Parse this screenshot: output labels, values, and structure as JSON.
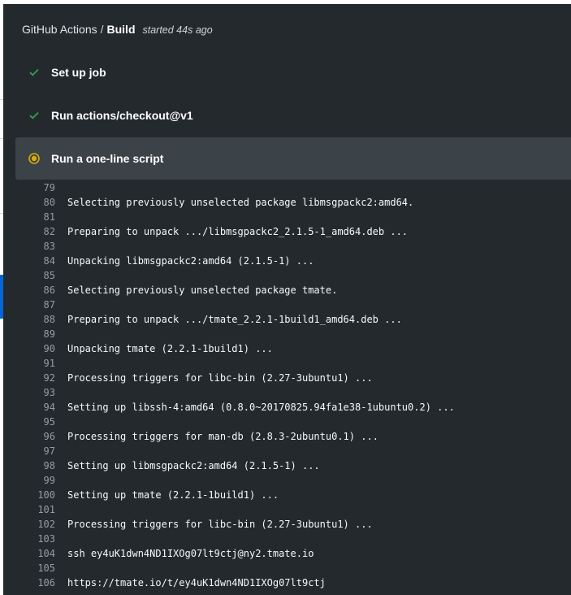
{
  "header": {
    "app": "GitHub Actions",
    "separator": "/",
    "workflow": "Build",
    "started": "started 44s ago"
  },
  "steps": [
    {
      "label": "Set up job",
      "status": "success",
      "icon": "check-icon"
    },
    {
      "label": "Run actions/checkout@v1",
      "status": "success",
      "icon": "check-icon"
    },
    {
      "label": "Run a one-line script",
      "status": "in-progress",
      "icon": "in-progress-icon"
    }
  ],
  "colors": {
    "panel_bg": "#24292e",
    "active_step_bg": "#3b4248",
    "success": "#28a745",
    "in_progress": "#dbab09",
    "accent": "#0366d6"
  },
  "log": [
    {
      "n": "79",
      "t": ""
    },
    {
      "n": "80",
      "t": "Selecting previously unselected package libmsgpackc2:amd64."
    },
    {
      "n": "81",
      "t": ""
    },
    {
      "n": "82",
      "t": "Preparing to unpack .../libmsgpackc2_2.1.5-1_amd64.deb ..."
    },
    {
      "n": "83",
      "t": ""
    },
    {
      "n": "84",
      "t": "Unpacking libmsgpackc2:amd64 (2.1.5-1) ..."
    },
    {
      "n": "85",
      "t": ""
    },
    {
      "n": "86",
      "t": "Selecting previously unselected package tmate."
    },
    {
      "n": "87",
      "t": ""
    },
    {
      "n": "88",
      "t": "Preparing to unpack .../tmate_2.2.1-1build1_amd64.deb ..."
    },
    {
      "n": "89",
      "t": ""
    },
    {
      "n": "90",
      "t": "Unpacking tmate (2.2.1-1build1) ..."
    },
    {
      "n": "91",
      "t": ""
    },
    {
      "n": "92",
      "t": "Processing triggers for libc-bin (2.27-3ubuntu1) ..."
    },
    {
      "n": "93",
      "t": ""
    },
    {
      "n": "94",
      "t": "Setting up libssh-4:amd64 (0.8.0~20170825.94fa1e38-1ubuntu0.2) ..."
    },
    {
      "n": "95",
      "t": ""
    },
    {
      "n": "96",
      "t": "Processing triggers for man-db (2.8.3-2ubuntu0.1) ..."
    },
    {
      "n": "97",
      "t": ""
    },
    {
      "n": "98",
      "t": "Setting up libmsgpackc2:amd64 (2.1.5-1) ..."
    },
    {
      "n": "99",
      "t": ""
    },
    {
      "n": "100",
      "t": "Setting up tmate (2.2.1-1build1) ..."
    },
    {
      "n": "101",
      "t": ""
    },
    {
      "n": "102",
      "t": "Processing triggers for libc-bin (2.27-3ubuntu1) ..."
    },
    {
      "n": "103",
      "t": ""
    },
    {
      "n": "104",
      "t": "ssh ey4uK1dwn4ND1IXOg07lt9ctj@ny2.tmate.io"
    },
    {
      "n": "105",
      "t": ""
    },
    {
      "n": "106",
      "t": "https://tmate.io/t/ey4uK1dwn4ND1IXOg07lt9ctj"
    }
  ]
}
